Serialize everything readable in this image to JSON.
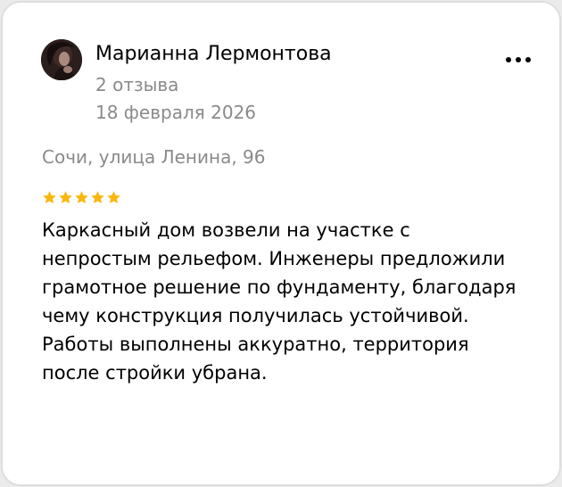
{
  "review": {
    "author_name": "Марианна Лермонтова",
    "reviews_count": "2 отзыва",
    "date": "18 февраля 2026",
    "address": "Сочи, улица Ленина, 96",
    "rating": 5,
    "rating_max": 5,
    "text": "Каркасный дом возвели на участке с\nнепростым рельефом. Инженеры предложили\nграмотное решение по фундаменту, благодаря\nчему конструкция получилась устойчивой.\nРаботы выполнены аккуратно, территория\nпосле стройки убрана."
  },
  "icons": {
    "more": "more-dots-icon",
    "star": "star-icon"
  },
  "colors": {
    "star": "#fbb710",
    "secondary_text": "#8a8a8a",
    "card_border": "#dedede"
  }
}
